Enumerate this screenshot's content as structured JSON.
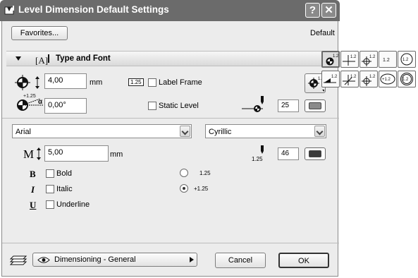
{
  "window": {
    "title": "Level Dimension Default Settings",
    "help_btn": "?",
    "close_btn": "✕"
  },
  "top": {
    "favorites_label": "Favorites...",
    "default_label": "Default"
  },
  "section": {
    "title": "Type and Font"
  },
  "marker": {
    "size_value": "4,00",
    "size_unit": "mm",
    "angle_value": "0,00°",
    "angle_tag": "α",
    "angle_small": "+1.25"
  },
  "label_frame": {
    "badge": "1.25",
    "label": "Label Frame",
    "checked": false
  },
  "static_level": {
    "label": "Static Level",
    "checked": false
  },
  "marker_pen": {
    "value": "25",
    "color": "#8a8a8a"
  },
  "font": {
    "name": "Arial",
    "script": "Cyrillic",
    "size_value": "5,00",
    "size_unit": "mm",
    "size_icon": "M",
    "pen_value": "46",
    "pen_color": "#3a3a3a",
    "pen_tag": "1.25"
  },
  "styles": [
    {
      "glyph": "B",
      "label": "Bold"
    },
    {
      "glyph": "I",
      "label": "Italic"
    },
    {
      "glyph": "U",
      "label": "Underline"
    }
  ],
  "prefix_options": [
    {
      "label": "1.25",
      "selected": false
    },
    {
      "label": "+1.25",
      "selected": true
    }
  ],
  "palette": {
    "row1": [
      "1.2",
      "1.2",
      "1.2",
      "1.2",
      "1.2"
    ],
    "row2": [
      "1.2",
      "1.2",
      "1.2",
      "+1.2",
      "1.2"
    ]
  },
  "bottom": {
    "layer": "Dimensioning - General",
    "cancel_label": "Cancel",
    "ok_label": "OK"
  }
}
